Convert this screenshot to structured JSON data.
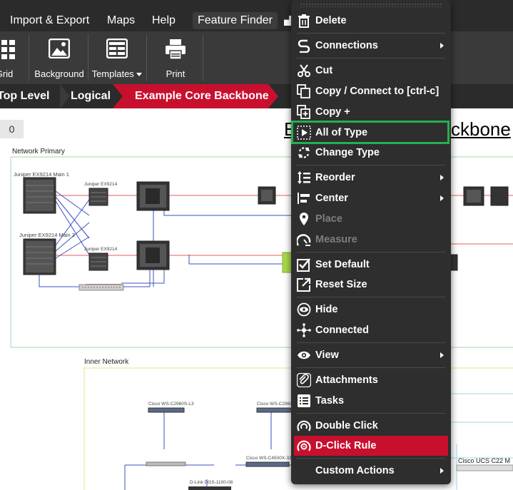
{
  "menubar": {
    "items": [
      "Import & Export",
      "Maps",
      "Help"
    ],
    "feature_finder": "Feature Finder"
  },
  "toolbar": {
    "grid_label": "Grid",
    "background_label": "Background",
    "templates_label": "Templates",
    "print_label": "Print"
  },
  "breadcrumb": {
    "items": [
      "Top Level",
      "Logical",
      "Example Core Backbone"
    ]
  },
  "canvas": {
    "zoom_value": "0",
    "title_left": "E",
    "title_right": "ckbone",
    "groups": {
      "network_primary": "Network Primary",
      "inner_network": "Inner Network"
    },
    "devices": {
      "main1": "Juniper EX9214 Main 1",
      "main2": "Juniper EX9214 Main 2",
      "ex1": "Juniper EX9214",
      "ex2": "Juniper EX9214",
      "cisco_a": "Cisco WS-C2960S-L3",
      "cisco_b": "Cisco WS-C2960S-L3",
      "cisco_c": "Cisco WS-C4500X-32S",
      "dlink": "D-Link DGS-1100-08",
      "ucs": "Cisco UCS C22 M"
    }
  },
  "context_menu": {
    "items": {
      "delete": "Delete",
      "connections": "Connections",
      "cut": "Cut",
      "copy_connect": "Copy / Connect to [ctrl-c]",
      "copy_plus": "Copy +",
      "all_of_type": "All of Type",
      "change_type": "Change Type",
      "reorder": "Reorder",
      "center": "Center",
      "place": "Place",
      "measure": "Measure",
      "set_default": "Set Default",
      "reset_size": "Reset Size",
      "hide": "Hide",
      "connected": "Connected",
      "view": "View",
      "attachments": "Attachments",
      "tasks": "Tasks",
      "double_click": "Double Click",
      "dclick_rule": "D-Click Rule",
      "custom_actions": "Custom Actions"
    },
    "icons": {
      "delete": "trash-icon",
      "connections": "link-icon",
      "cut": "scissors-icon",
      "copy_connect": "copy-icon",
      "copy_plus": "copy-plus-icon",
      "all_of_type": "select-all-icon",
      "change_type": "swap-icon",
      "reorder": "reorder-icon",
      "center": "center-icon",
      "place": "pin-icon",
      "measure": "measure-icon",
      "set_default": "checkbox-icon",
      "reset_size": "external-arrow-icon",
      "hide": "hide-icon",
      "connected": "network-icon",
      "view": "eye-icon",
      "attachments": "paperclip-icon",
      "tasks": "list-icon",
      "double_click": "click-icon",
      "dclick_rule": "click-rule-icon"
    },
    "highlighted_item": "All of Type",
    "active_item": "D-Click Rule",
    "disabled_items": [
      "Place",
      "Measure"
    ]
  },
  "colors": {
    "menubar_bg": "#2b2b2b",
    "toolbar_bg": "#3a3a3a",
    "accent_red": "#c8102e",
    "highlight_green": "#22b14c",
    "menu_bg": "#2e2e2e"
  }
}
